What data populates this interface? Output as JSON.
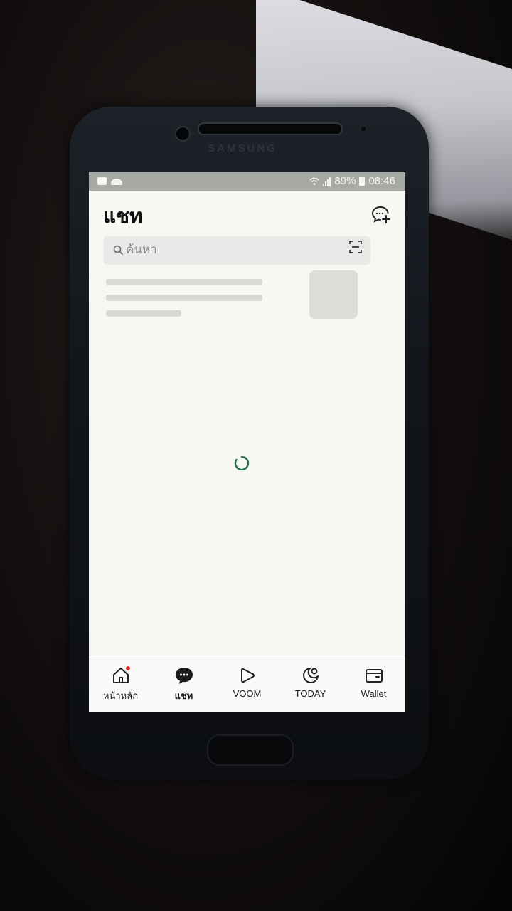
{
  "status_bar": {
    "battery": "89%",
    "time": "08:46"
  },
  "header": {
    "title": "แชท",
    "new_chat_icon": "chat-add-icon"
  },
  "search": {
    "placeholder": "ค้นหา",
    "scan_icon": "qr-scan-icon"
  },
  "loading": {
    "icon": "spinner-icon",
    "color": "#1f6f55"
  },
  "device": {
    "brand": "SAMSUNG"
  },
  "tabs": [
    {
      "label": "หน้าหลัก",
      "icon": "home-icon",
      "badge": true
    },
    {
      "label": "แชท",
      "icon": "chat-bubble-icon",
      "active": true
    },
    {
      "label": "VOOM",
      "icon": "voom-play-icon"
    },
    {
      "label": "TODAY",
      "icon": "today-icon"
    },
    {
      "label": "Wallet",
      "icon": "wallet-icon"
    }
  ],
  "colors": {
    "badge": "#e0242e",
    "status_bar_bg": "#a7a9a4",
    "skeleton": "#d9d9d6"
  }
}
